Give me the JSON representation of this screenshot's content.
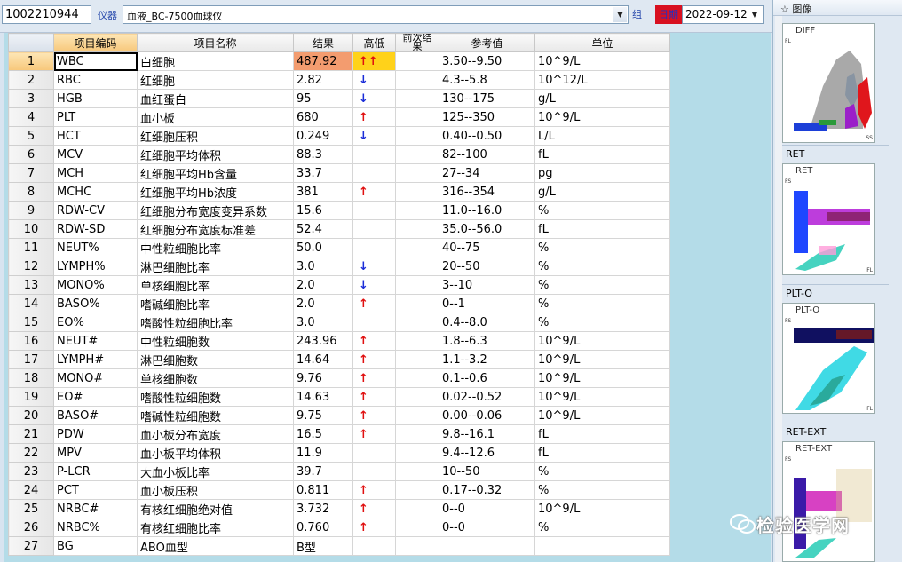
{
  "toolbar": {
    "sample_id": "1002210944",
    "instrument_label": "仪器",
    "instrument_value": "血液_BC-7500血球仪",
    "group_label": "组",
    "date_label": "日期",
    "date_value": "2022-09-12"
  },
  "table": {
    "headers": [
      "项目编码",
      "项目名称",
      "结果",
      "高低",
      "前次结果",
      "参考值",
      "单位"
    ],
    "rows": [
      {
        "no": "1",
        "code": "WBC",
        "name": "白细胞",
        "result": "487.92",
        "flag": "↑↑",
        "ref": "3.50--9.50",
        "unit": "10^9/L"
      },
      {
        "no": "2",
        "code": "RBC",
        "name": "红细胞",
        "result": "2.82",
        "flag": "↓",
        "ref": "4.3--5.8",
        "unit": "10^12/L"
      },
      {
        "no": "3",
        "code": "HGB",
        "name": "血红蛋白",
        "result": "95",
        "flag": "↓",
        "ref": "130--175",
        "unit": "g/L"
      },
      {
        "no": "4",
        "code": "PLT",
        "name": "血小板",
        "result": "680",
        "flag": "↑",
        "ref": "125--350",
        "unit": "10^9/L"
      },
      {
        "no": "5",
        "code": "HCT",
        "name": "红细胞压积",
        "result": "0.249",
        "flag": "↓",
        "ref": "0.40--0.50",
        "unit": "L/L"
      },
      {
        "no": "6",
        "code": "MCV",
        "name": "红细胞平均体积",
        "result": "88.3",
        "flag": "",
        "ref": "82--100",
        "unit": "fL"
      },
      {
        "no": "7",
        "code": "MCH",
        "name": "红细胞平均Hb含量",
        "result": "33.7",
        "flag": "",
        "ref": "27--34",
        "unit": "pg"
      },
      {
        "no": "8",
        "code": "MCHC",
        "name": "红细胞平均Hb浓度",
        "result": "381",
        "flag": "↑",
        "ref": "316--354",
        "unit": "g/L"
      },
      {
        "no": "9",
        "code": "RDW-CV",
        "name": "红细胞分布宽度变异系数",
        "result": "15.6",
        "flag": "",
        "ref": "11.0--16.0",
        "unit": "%"
      },
      {
        "no": "10",
        "code": "RDW-SD",
        "name": "红细胞分布宽度标准差",
        "result": "52.4",
        "flag": "",
        "ref": "35.0--56.0",
        "unit": "fL"
      },
      {
        "no": "11",
        "code": "NEUT%",
        "name": "中性粒细胞比率",
        "result": "50.0",
        "flag": "",
        "ref": "40--75",
        "unit": "%"
      },
      {
        "no": "12",
        "code": "LYMPH%",
        "name": "淋巴细胞比率",
        "result": "3.0",
        "flag": "↓",
        "ref": "20--50",
        "unit": "%"
      },
      {
        "no": "13",
        "code": "MONO%",
        "name": "单核细胞比率",
        "result": "2.0",
        "flag": "↓",
        "ref": "3--10",
        "unit": "%"
      },
      {
        "no": "14",
        "code": "BASO%",
        "name": "嗜碱细胞比率",
        "result": "2.0",
        "flag": "↑",
        "ref": "0--1",
        "unit": "%"
      },
      {
        "no": "15",
        "code": "EO%",
        "name": "嗜酸性粒细胞比率",
        "result": "3.0",
        "flag": "",
        "ref": "0.4--8.0",
        "unit": "%"
      },
      {
        "no": "16",
        "code": "NEUT#",
        "name": "中性粒细胞数",
        "result": "243.96",
        "flag": "↑",
        "ref": "1.8--6.3",
        "unit": "10^9/L"
      },
      {
        "no": "17",
        "code": "LYMPH#",
        "name": "淋巴细胞数",
        "result": "14.64",
        "flag": "↑",
        "ref": "1.1--3.2",
        "unit": "10^9/L"
      },
      {
        "no": "18",
        "code": "MONO#",
        "name": "单核细胞数",
        "result": "9.76",
        "flag": "↑",
        "ref": "0.1--0.6",
        "unit": "10^9/L"
      },
      {
        "no": "19",
        "code": "EO#",
        "name": "嗜酸性粒细胞数",
        "result": "14.63",
        "flag": "↑",
        "ref": "0.02--0.52",
        "unit": "10^9/L"
      },
      {
        "no": "20",
        "code": "BASO#",
        "name": "嗜碱性粒细胞数",
        "result": "9.75",
        "flag": "↑",
        "ref": "0.00--0.06",
        "unit": "10^9/L"
      },
      {
        "no": "21",
        "code": "PDW",
        "name": "血小板分布宽度",
        "result": "16.5",
        "flag": "↑",
        "ref": "9.8--16.1",
        "unit": "fL"
      },
      {
        "no": "22",
        "code": "MPV",
        "name": "血小板平均体积",
        "result": "11.9",
        "flag": "",
        "ref": "9.4--12.6",
        "unit": "fL"
      },
      {
        "no": "23",
        "code": "P-LCR",
        "name": "大血小板比率",
        "result": "39.7",
        "flag": "",
        "ref": "10--50",
        "unit": "%"
      },
      {
        "no": "24",
        "code": "PCT",
        "name": "血小板压积",
        "result": "0.811",
        "flag": "↑",
        "ref": "0.17--0.32",
        "unit": "%"
      },
      {
        "no": "25",
        "code": "NRBC#",
        "name": "有核红细胞绝对值",
        "result": "3.732",
        "flag": "↑",
        "ref": "0--0",
        "unit": "10^9/L"
      },
      {
        "no": "26",
        "code": "NRBC%",
        "name": "有核红细胞比率",
        "result": "0.760",
        "flag": "↑",
        "ref": "0--0",
        "unit": "%"
      },
      {
        "no": "27",
        "code": "BG",
        "name": "ABO血型",
        "result": "B型",
        "flag": "",
        "ref": "",
        "unit": ""
      }
    ]
  },
  "images_panel": {
    "title": "☆ 图像",
    "plots": [
      {
        "name": "DIFF",
        "label": "",
        "x_axis": "SS",
        "y_axis": "FL"
      },
      {
        "name": "RET",
        "label": "RET",
        "x_axis": "FL",
        "y_axis": "FS"
      },
      {
        "name": "PLT-O",
        "label": "PLT-O",
        "x_axis": "FL",
        "y_axis": "FS"
      },
      {
        "name": "RET-EXT",
        "label": "RET-EXT",
        "x_axis": "FL",
        "y_axis": "FS"
      }
    ]
  },
  "watermark": "检验医学网",
  "colors": {
    "up": "#e01010",
    "down": "#1a2cd8",
    "high_result": "#f39c6f",
    "flag_highlight": "#ffd21a"
  }
}
